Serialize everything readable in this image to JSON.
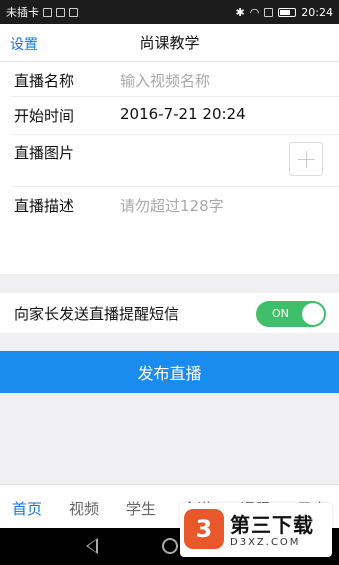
{
  "status_bar": {
    "carrier": "未插卡",
    "time": "20:24"
  },
  "nav": {
    "left_label": "设置",
    "title": "尚课教学"
  },
  "form": {
    "live_name_label": "直播名称",
    "live_name_placeholder": "输入视频名称",
    "start_time_label": "开始时间",
    "start_time_value": "2016-7-21 20:24",
    "image_label": "直播图片",
    "description_label": "直播描述",
    "description_placeholder": "请勿超过128字"
  },
  "sms": {
    "label": "向家长发送直播提醒短信",
    "toggle_text": "ON",
    "enabled": true
  },
  "publish_label": "发布直播",
  "tabs": [
    {
      "label": "首页",
      "active": true
    },
    {
      "label": "视频",
      "active": false
    },
    {
      "label": "学生",
      "active": false
    },
    {
      "label": "食谱",
      "active": false
    },
    {
      "label": "课程",
      "active": false
    },
    {
      "label": "用户",
      "active": false
    }
  ],
  "watermark": {
    "logo_char": "3",
    "title": "第三下载",
    "subtitle": "D3XZ.COM"
  },
  "colors": {
    "accent": "#1a8cf0",
    "toggle_on": "#3fbf6a",
    "link": "#1a73d9"
  }
}
